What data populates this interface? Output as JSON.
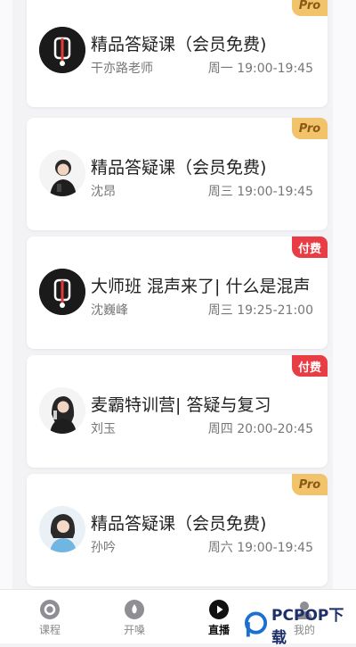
{
  "cards": [
    {
      "title": "精品答疑课（会员免费)",
      "teacher": "干亦路老师",
      "time": "周一 19:00-19:45",
      "badge": "Pro",
      "avatar": "logo"
    },
    {
      "title": "精品答疑课（会员免费)",
      "teacher": "沈昂",
      "time": "周三 19:00-19:45",
      "badge": "Pro",
      "avatar": "person"
    },
    {
      "title": "大师班 混声来了| 什么是混声",
      "teacher": "沈巍峰",
      "time": "周三 19:25-21:00",
      "badge": "付费",
      "avatar": "logo"
    },
    {
      "title": "麦霸特训营| 答疑与复习",
      "teacher": "刘玉",
      "time": "周四 20:00-20:45",
      "badge": "付费",
      "avatar": "person"
    },
    {
      "title": "精品答疑课（会员免费)",
      "teacher": "孙吟",
      "time": "周六 19:00-19:45",
      "badge": "Pro",
      "avatar": "person"
    }
  ],
  "nav": [
    {
      "label": "课程",
      "icon": "course-icon"
    },
    {
      "label": "开嗓",
      "icon": "warmup-icon"
    },
    {
      "label": "直播",
      "icon": "live-icon",
      "active": true
    },
    {
      "label": "我的",
      "icon": "profile-icon"
    }
  ],
  "watermark": {
    "text": "PCPOP下载"
  },
  "colors": {
    "pro_badge": "#f1c46b",
    "paid_badge": "#e83d45",
    "background": "#f3f3f6"
  }
}
